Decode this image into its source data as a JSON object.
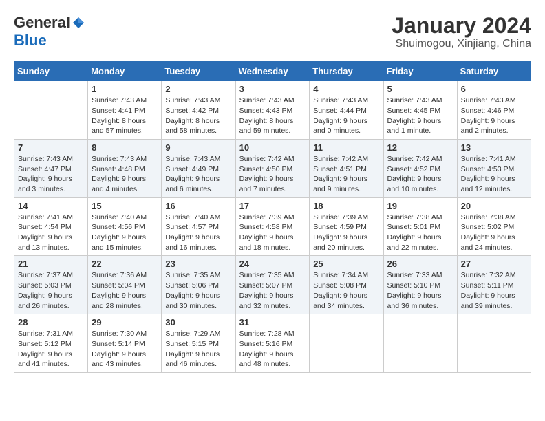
{
  "header": {
    "logo_general": "General",
    "logo_blue": "Blue",
    "month_year": "January 2024",
    "location": "Shuimogou, Xinjiang, China"
  },
  "calendar": {
    "days_of_week": [
      "Sunday",
      "Monday",
      "Tuesday",
      "Wednesday",
      "Thursday",
      "Friday",
      "Saturday"
    ],
    "weeks": [
      [
        {
          "day": "",
          "info": ""
        },
        {
          "day": "1",
          "info": "Sunrise: 7:43 AM\nSunset: 4:41 PM\nDaylight: 8 hours\nand 57 minutes."
        },
        {
          "day": "2",
          "info": "Sunrise: 7:43 AM\nSunset: 4:42 PM\nDaylight: 8 hours\nand 58 minutes."
        },
        {
          "day": "3",
          "info": "Sunrise: 7:43 AM\nSunset: 4:43 PM\nDaylight: 8 hours\nand 59 minutes."
        },
        {
          "day": "4",
          "info": "Sunrise: 7:43 AM\nSunset: 4:44 PM\nDaylight: 9 hours\nand 0 minutes."
        },
        {
          "day": "5",
          "info": "Sunrise: 7:43 AM\nSunset: 4:45 PM\nDaylight: 9 hours\nand 1 minute."
        },
        {
          "day": "6",
          "info": "Sunrise: 7:43 AM\nSunset: 4:46 PM\nDaylight: 9 hours\nand 2 minutes."
        }
      ],
      [
        {
          "day": "7",
          "info": "Sunrise: 7:43 AM\nSunset: 4:47 PM\nDaylight: 9 hours\nand 3 minutes."
        },
        {
          "day": "8",
          "info": "Sunrise: 7:43 AM\nSunset: 4:48 PM\nDaylight: 9 hours\nand 4 minutes."
        },
        {
          "day": "9",
          "info": "Sunrise: 7:43 AM\nSunset: 4:49 PM\nDaylight: 9 hours\nand 6 minutes."
        },
        {
          "day": "10",
          "info": "Sunrise: 7:42 AM\nSunset: 4:50 PM\nDaylight: 9 hours\nand 7 minutes."
        },
        {
          "day": "11",
          "info": "Sunrise: 7:42 AM\nSunset: 4:51 PM\nDaylight: 9 hours\nand 9 minutes."
        },
        {
          "day": "12",
          "info": "Sunrise: 7:42 AM\nSunset: 4:52 PM\nDaylight: 9 hours\nand 10 minutes."
        },
        {
          "day": "13",
          "info": "Sunrise: 7:41 AM\nSunset: 4:53 PM\nDaylight: 9 hours\nand 12 minutes."
        }
      ],
      [
        {
          "day": "14",
          "info": "Sunrise: 7:41 AM\nSunset: 4:54 PM\nDaylight: 9 hours\nand 13 minutes."
        },
        {
          "day": "15",
          "info": "Sunrise: 7:40 AM\nSunset: 4:56 PM\nDaylight: 9 hours\nand 15 minutes."
        },
        {
          "day": "16",
          "info": "Sunrise: 7:40 AM\nSunset: 4:57 PM\nDaylight: 9 hours\nand 16 minutes."
        },
        {
          "day": "17",
          "info": "Sunrise: 7:39 AM\nSunset: 4:58 PM\nDaylight: 9 hours\nand 18 minutes."
        },
        {
          "day": "18",
          "info": "Sunrise: 7:39 AM\nSunset: 4:59 PM\nDaylight: 9 hours\nand 20 minutes."
        },
        {
          "day": "19",
          "info": "Sunrise: 7:38 AM\nSunset: 5:01 PM\nDaylight: 9 hours\nand 22 minutes."
        },
        {
          "day": "20",
          "info": "Sunrise: 7:38 AM\nSunset: 5:02 PM\nDaylight: 9 hours\nand 24 minutes."
        }
      ],
      [
        {
          "day": "21",
          "info": "Sunrise: 7:37 AM\nSunset: 5:03 PM\nDaylight: 9 hours\nand 26 minutes."
        },
        {
          "day": "22",
          "info": "Sunrise: 7:36 AM\nSunset: 5:04 PM\nDaylight: 9 hours\nand 28 minutes."
        },
        {
          "day": "23",
          "info": "Sunrise: 7:35 AM\nSunset: 5:06 PM\nDaylight: 9 hours\nand 30 minutes."
        },
        {
          "day": "24",
          "info": "Sunrise: 7:35 AM\nSunset: 5:07 PM\nDaylight: 9 hours\nand 32 minutes."
        },
        {
          "day": "25",
          "info": "Sunrise: 7:34 AM\nSunset: 5:08 PM\nDaylight: 9 hours\nand 34 minutes."
        },
        {
          "day": "26",
          "info": "Sunrise: 7:33 AM\nSunset: 5:10 PM\nDaylight: 9 hours\nand 36 minutes."
        },
        {
          "day": "27",
          "info": "Sunrise: 7:32 AM\nSunset: 5:11 PM\nDaylight: 9 hours\nand 39 minutes."
        }
      ],
      [
        {
          "day": "28",
          "info": "Sunrise: 7:31 AM\nSunset: 5:12 PM\nDaylight: 9 hours\nand 41 minutes."
        },
        {
          "day": "29",
          "info": "Sunrise: 7:30 AM\nSunset: 5:14 PM\nDaylight: 9 hours\nand 43 minutes."
        },
        {
          "day": "30",
          "info": "Sunrise: 7:29 AM\nSunset: 5:15 PM\nDaylight: 9 hours\nand 46 minutes."
        },
        {
          "day": "31",
          "info": "Sunrise: 7:28 AM\nSunset: 5:16 PM\nDaylight: 9 hours\nand 48 minutes."
        },
        {
          "day": "",
          "info": ""
        },
        {
          "day": "",
          "info": ""
        },
        {
          "day": "",
          "info": ""
        }
      ]
    ]
  }
}
